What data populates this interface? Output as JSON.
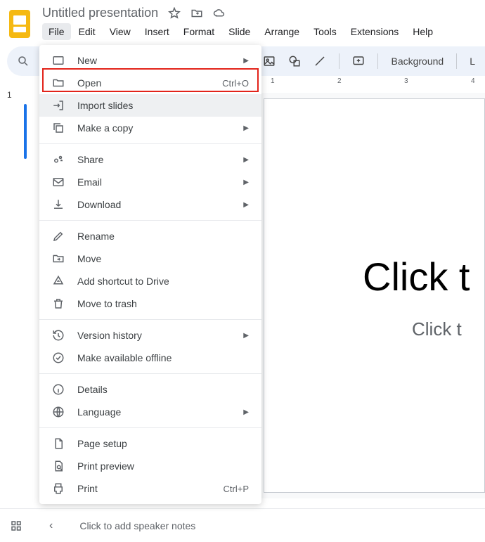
{
  "header": {
    "doc_title": "Untitled presentation"
  },
  "menubar": {
    "file": "File",
    "edit": "Edit",
    "view": "View",
    "insert": "Insert",
    "format": "Format",
    "slide": "Slide",
    "arrange": "Arrange",
    "tools": "Tools",
    "extensions": "Extensions",
    "help": "Help"
  },
  "toolbar": {
    "background": "Background",
    "layout_initial": "L"
  },
  "ruler": {
    "t1": "1",
    "t2": "2",
    "t3": "3",
    "t4": "4"
  },
  "thumbnails": {
    "n1": "1"
  },
  "canvas": {
    "title": "Click t",
    "subtitle": "Click t"
  },
  "file_menu": {
    "new": "New",
    "open": "Open",
    "open_shortcut": "Ctrl+O",
    "import": "Import slides",
    "copy": "Make a copy",
    "share": "Share",
    "email": "Email",
    "download": "Download",
    "rename": "Rename",
    "move": "Move",
    "shortcut": "Add shortcut to Drive",
    "trash": "Move to trash",
    "version": "Version history",
    "offline": "Make available offline",
    "details": "Details",
    "language": "Language",
    "page_setup": "Page setup",
    "print_preview": "Print preview",
    "print": "Print",
    "print_shortcut": "Ctrl+P"
  },
  "footer": {
    "notes": "Click to add speaker notes"
  }
}
